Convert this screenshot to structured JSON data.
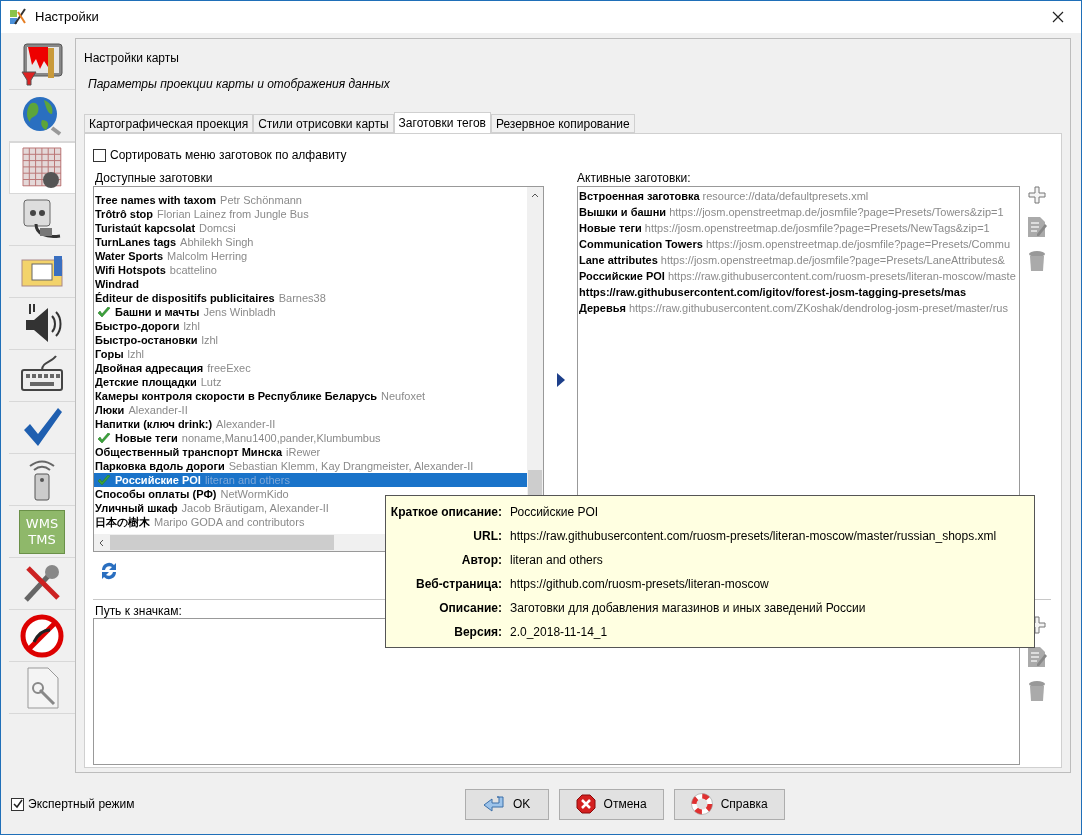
{
  "window": {
    "title": "Настройки"
  },
  "sidebar": {
    "items": [
      {
        "kind": "paint",
        "selected": false
      },
      {
        "kind": "globe",
        "selected": false
      },
      {
        "kind": "grid",
        "selected": true
      },
      {
        "kind": "plug",
        "selected": false
      },
      {
        "kind": "folder",
        "selected": false
      },
      {
        "kind": "speaker",
        "selected": false
      },
      {
        "kind": "keyboard",
        "selected": false
      },
      {
        "kind": "check",
        "selected": false
      },
      {
        "kind": "remote",
        "selected": false
      },
      {
        "kind": "wms",
        "selected": false,
        "labels": [
          "WMS",
          "TMS"
        ]
      },
      {
        "kind": "tools",
        "selected": false
      },
      {
        "kind": "forbidden",
        "selected": false
      },
      {
        "kind": "document",
        "selected": false
      }
    ]
  },
  "header": {
    "title": "Настройки карты",
    "subtitle": "Параметры проекции карты и отображения данных"
  },
  "tabs": [
    {
      "label": "Картографическая проекция",
      "selected": false
    },
    {
      "label": "Стили отрисовки карты",
      "selected": false
    },
    {
      "label": "Заготовки тегов",
      "selected": true
    },
    {
      "label": "Резервное копирование",
      "selected": false
    }
  ],
  "sort_checkbox": {
    "label": "Сортировать меню заготовок по алфавиту",
    "checked": false
  },
  "available": {
    "label": "Доступные заготовки",
    "items": [
      {
        "name": "Tree names with taxom",
        "author": "Petr Schönmann",
        "active": false,
        "selected": false
      },
      {
        "name": "Trôtrô stop",
        "author": "Florian Lainez from Jungle Bus",
        "active": false,
        "selected": false
      },
      {
        "name": "Turistaút kapcsolat",
        "author": "Domcsi",
        "active": false,
        "selected": false
      },
      {
        "name": "TurnLanes tags",
        "author": "Abhilekh Singh",
        "active": false,
        "selected": false
      },
      {
        "name": "Water Sports",
        "author": "Malcolm Herring",
        "active": false,
        "selected": false
      },
      {
        "name": "Wifi Hotspots",
        "author": "bcattelino",
        "active": false,
        "selected": false
      },
      {
        "name": "Windrad",
        "active": false,
        "selected": false
      },
      {
        "name": "Éditeur de dispositifs publicitaires",
        "author": "Barnes38",
        "active": false,
        "selected": false
      },
      {
        "name": "Башни и мачты",
        "author": "Jens Winbladh",
        "active": true,
        "selected": false
      },
      {
        "name": "Быстро-дороги",
        "author": "lzhl",
        "active": false,
        "selected": false
      },
      {
        "name": "Быстро-остановки",
        "author": "lzhl",
        "active": false,
        "selected": false
      },
      {
        "name": "Горы",
        "author": "lzhl",
        "active": false,
        "selected": false
      },
      {
        "name": "Двойная адресация",
        "author": "freeExec",
        "active": false,
        "selected": false
      },
      {
        "name": "Детские площадки",
        "author": "Lutz",
        "active": false,
        "selected": false
      },
      {
        "name": "Камеры контроля скорости в Республике Беларусь",
        "author": "Neufoxet",
        "active": false,
        "selected": false
      },
      {
        "name": "Люки",
        "author": "Alexander-II",
        "active": false,
        "selected": false
      },
      {
        "name": "Напитки (ключ drink:)",
        "author": "Alexander-II",
        "active": false,
        "selected": false
      },
      {
        "name": "Новые теги",
        "author": "noname,Manu1400,pander,Klumbumbus",
        "active": true,
        "selected": false
      },
      {
        "name": "Общественный транспорт Минска",
        "author": "iRewer",
        "active": false,
        "selected": false
      },
      {
        "name": "Парковка вдоль дороги",
        "author": "Sebastian Klemm, Kay Drangmeister, Alexander-II",
        "active": false,
        "selected": false
      },
      {
        "name": "Российские POI",
        "author": "literan and others",
        "active": true,
        "selected": true
      },
      {
        "name": "Способы оплаты (РФ)",
        "author": "NetWormKido",
        "active": false,
        "selected": false
      },
      {
        "name": "Уличный шкаф",
        "author": "Jacob Bräutigam, Alexander-II",
        "active": false,
        "selected": false
      },
      {
        "name": "日本の樹木",
        "author": "Maripo GODA and contributors",
        "active": false,
        "selected": false
      }
    ]
  },
  "active": {
    "label": "Активные заготовки:",
    "items": [
      {
        "name": "Встроенная заготовка",
        "url": "resource://data/defaultpresets.xml"
      },
      {
        "name": "Вышки и башни",
        "url": "https://josm.openstreetmap.de/josmfile?page=Presets/Towers&zip=1"
      },
      {
        "name": "Новые теги",
        "url": "https://josm.openstreetmap.de/josmfile?page=Presets/NewTags&zip=1"
      },
      {
        "name": "Communication Towers",
        "url": "https://josm.openstreetmap.de/josmfile?page=Presets/Commu"
      },
      {
        "name": "Lane attributes",
        "url": "https://josm.openstreetmap.de/josmfile?page=Presets/LaneAttributes&"
      },
      {
        "name": "Российские POI",
        "url": "https://raw.githubusercontent.com/ruosm-presets/literan-moscow/maste"
      },
      {
        "name": "https://raw.githubusercontent.com/igitov/forest-josm-tagging-presets/mas"
      },
      {
        "name": "Деревья",
        "url": "https://raw.githubusercontent.com/ZKoshak/dendrolog-josm-preset/master/rus"
      }
    ]
  },
  "icon_path": {
    "label": "Путь к значкам:"
  },
  "tooltip": {
    "rows": [
      {
        "label": "Краткое описание:",
        "value": "Российские POI"
      },
      {
        "label": "URL:",
        "value": "https://raw.githubusercontent.com/ruosm-presets/literan-moscow/master/russian_shops.xml"
      },
      {
        "label": "Автор:",
        "value": "literan and others"
      },
      {
        "label": "Веб-страница:",
        "value": "https://github.com/ruosm-presets/literan-moscow"
      },
      {
        "label": "Описание:",
        "value": "Заготовки для добавления магазинов и иных заведений России"
      },
      {
        "label": "Версия:",
        "value": "2.0_2018-11-14_1"
      }
    ]
  },
  "expert_mode": {
    "label": "Экспертный режим",
    "checked": true
  },
  "buttons": [
    {
      "kind": "ok",
      "label": "OK"
    },
    {
      "kind": "cancel",
      "label": "Отмена"
    },
    {
      "kind": "help",
      "label": "Справка"
    }
  ]
}
